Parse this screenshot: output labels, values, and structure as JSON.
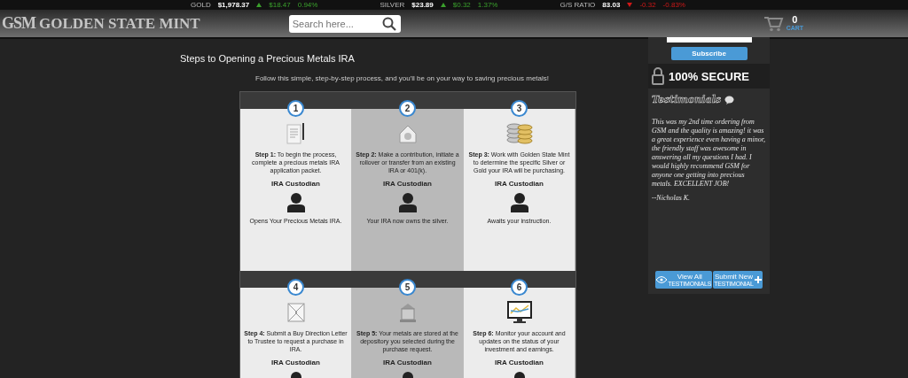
{
  "ticker": [
    {
      "label": "GOLD",
      "price": "$1,978.37",
      "kind": "up",
      "change": "$18.47",
      "percent": "0.94%"
    },
    {
      "label": "SILVER",
      "price": "$23.89",
      "kind": "up",
      "change": "$0.32",
      "percent": "1.37%"
    },
    {
      "label": "G/S RATIO",
      "price": "83.03",
      "kind": "down",
      "change": "-0.32",
      "percent": "-0.83%"
    }
  ],
  "header": {
    "logo_mark": "GSM",
    "logo_text": "GOLDEN STATE MINT",
    "search": {
      "placeholder": "Search here..."
    },
    "cart": {
      "count": "0",
      "label": "CART"
    }
  },
  "main": {
    "title": "Steps to Opening a Precious Metals IRA",
    "intro": "Follow this simple, step-by-step process, and you'll be on your way to saving precious metals!",
    "steps": [
      {
        "number": "1",
        "kind": "document",
        "text": "**Step 1:** To begin the process, complete a precious metals IRA application packet.",
        "role": "IRA Custodian",
        "result": "Opens Your Precious Metals IRA."
      },
      {
        "number": "2",
        "kind": "house",
        "text": "**Step 2:** Make a contribution, initiate a rollover or transfer from an existing IRA or 401(k).",
        "role": "IRA Custodian",
        "result": "Your IRA now owns the silver."
      },
      {
        "number": "3",
        "kind": "coins",
        "text": "**Step 3:** Work with Golden State Mint to determine the specific Silver or Gold your IRA will be purchasing.",
        "role": "IRA Custodian",
        "result": "Awaits your instruction."
      },
      {
        "number": "4",
        "kind": "envelope",
        "text": "**Step 4:** Submit a Buy Direction Letter to Trustee to request a purchase in IRA.",
        "role": "IRA Custodian"
      },
      {
        "number": "5",
        "kind": "building",
        "text": "**Step 5:** Your metals are stored at the depository you selected during the purchase request.",
        "role": "IRA Custodian"
      },
      {
        "number": "6",
        "kind": "monitor",
        "text": "**Step 6:** Monitor your account and updates on the status of your investment and earnings.",
        "role": "IRA Custodian"
      }
    ]
  },
  "sidebar": {
    "subscribe_button": "Subscribe",
    "secure_badge": "100% SECURE",
    "testimonials": {
      "title": "Testimonials",
      "quote": "This was my 2nd time ordering from GSM and the quality is amazing! it was a great experience even having a minor, the friendly staff was awesome in answering all my questions I had. I would highly recommend GSM for anyone one getting into precious metals. EXCELLENT JOB!",
      "author": "--Nicholas K.",
      "buttons": [
        {
          "kind": "view",
          "label": "View All",
          "sublabel": "TESTIMONIALS"
        },
        {
          "kind": "submit",
          "label": "Submit New",
          "sublabel": "TESTIMONIAL"
        }
      ]
    }
  }
}
